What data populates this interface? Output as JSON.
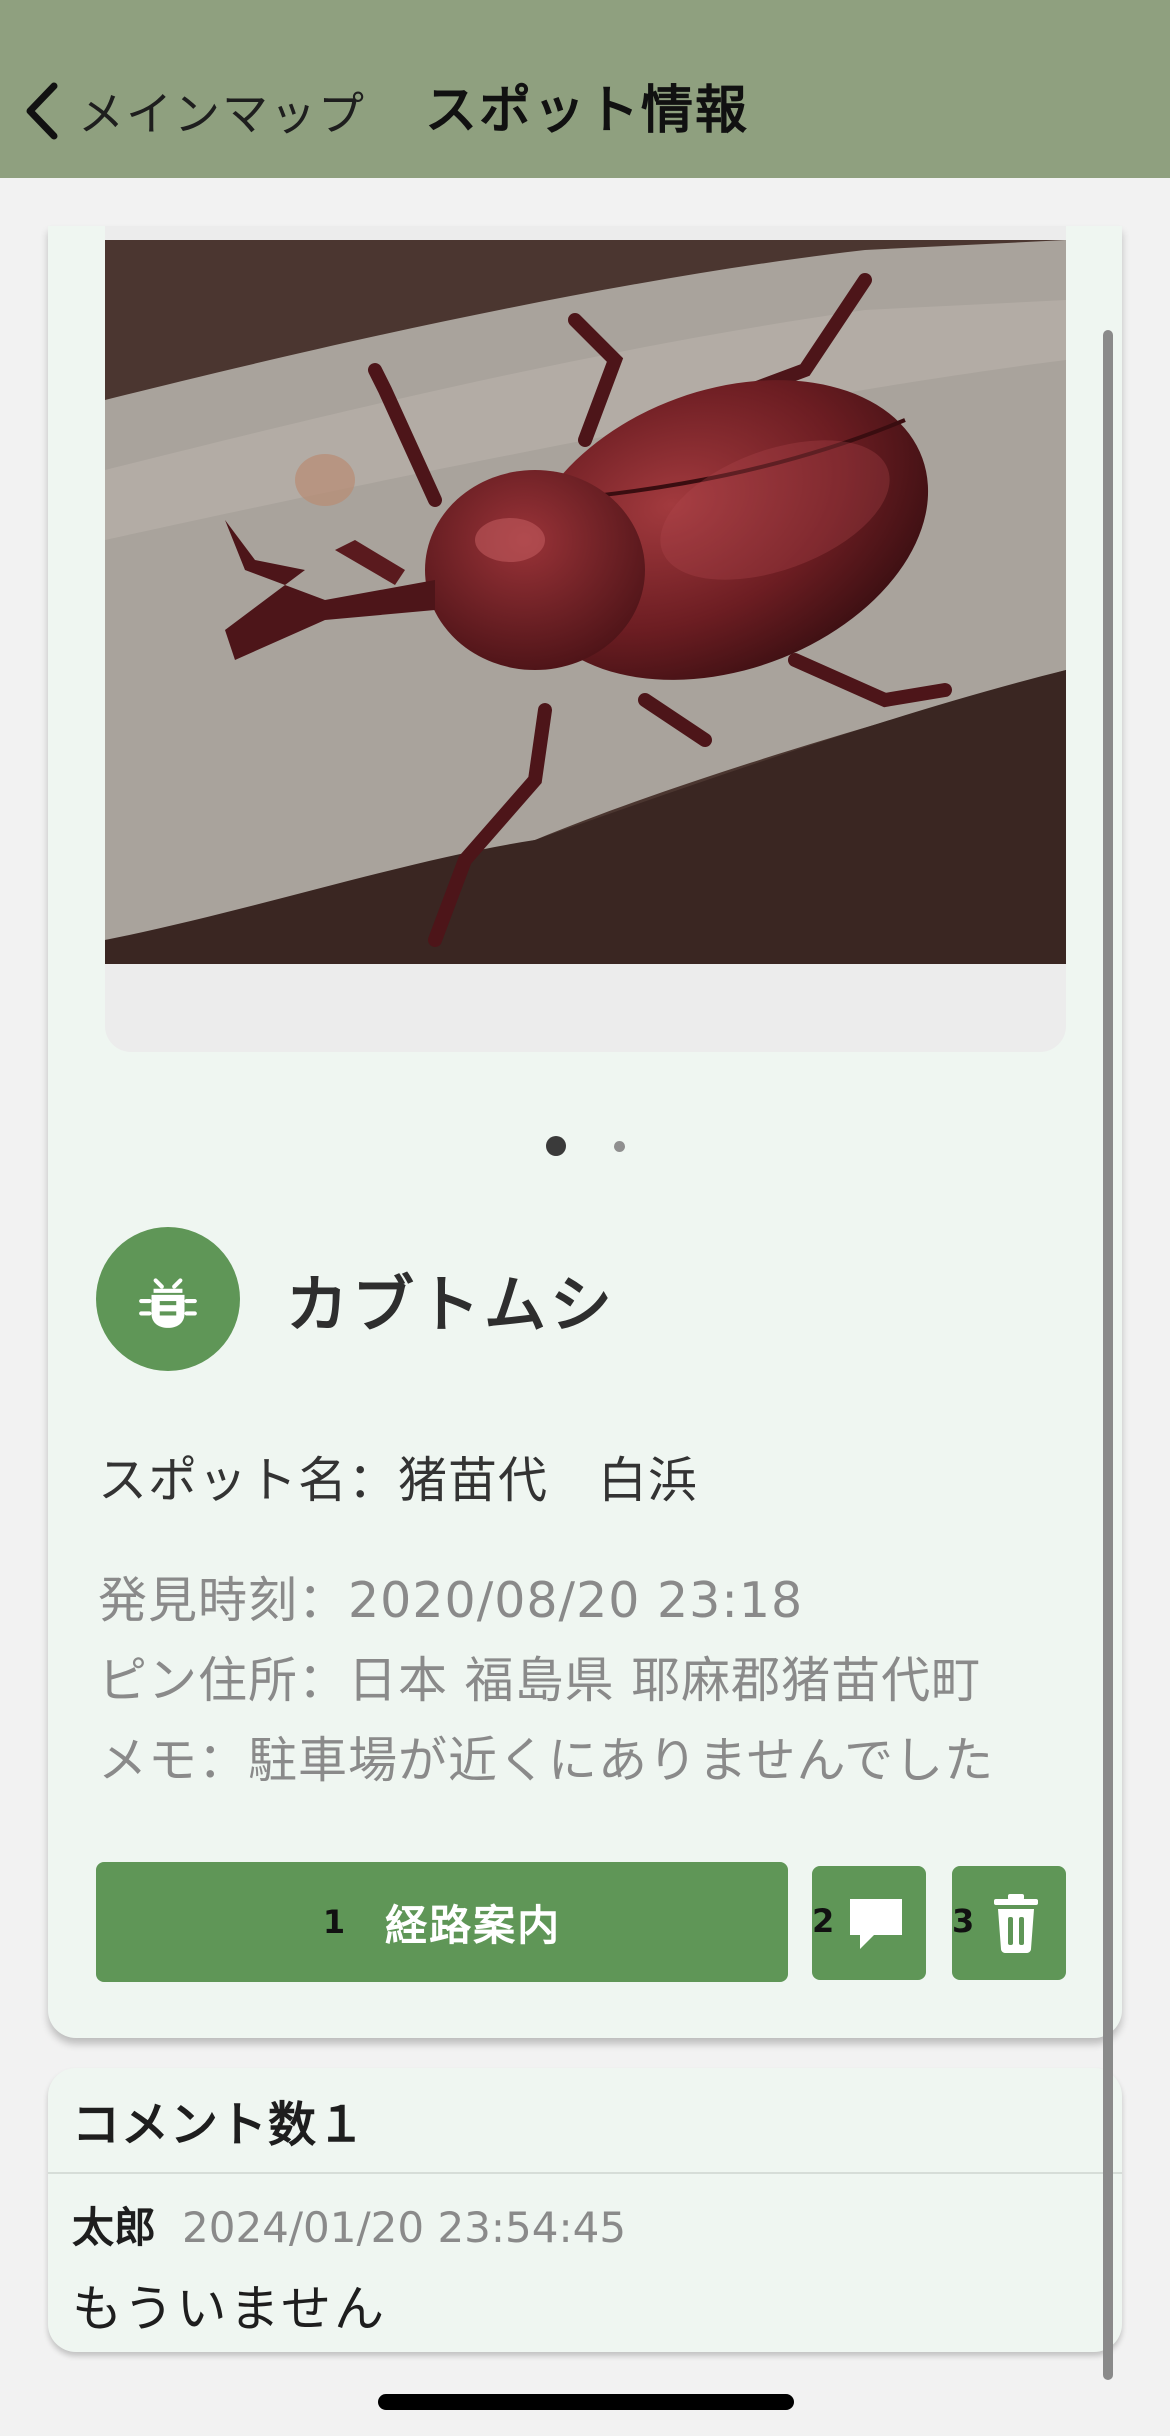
{
  "header": {
    "back_label": "メインマップ",
    "title": "スポット情報"
  },
  "spot": {
    "carousel": {
      "count": 2,
      "active_index": 0
    },
    "species_icon": "bug-icon",
    "species_name": "カブトムシ",
    "spot_name_line": "スポット名：猪苗代　白浜",
    "found_time_line": "発見時刻：2020/08/20 23:18",
    "pin_address_line": "ピン住所：日本 福島県 耶麻郡猪苗代町",
    "memo_line": "メモ：駐車場が近くにありませんでした"
  },
  "actions": {
    "route": {
      "index": "1",
      "label": "経路案内"
    },
    "comment": {
      "index": "2",
      "icon": "comment-icon"
    },
    "delete": {
      "index": "3",
      "icon": "trash-icon"
    }
  },
  "comments": {
    "header": "コメント数１",
    "items": [
      {
        "user": "太郎",
        "time": "2024/01/20 23:54:45",
        "text": "もういません"
      }
    ]
  },
  "colors": {
    "header_bg": "#8fa07f",
    "accent_green": "#5f9657",
    "card_bg": "#eff6f1"
  }
}
